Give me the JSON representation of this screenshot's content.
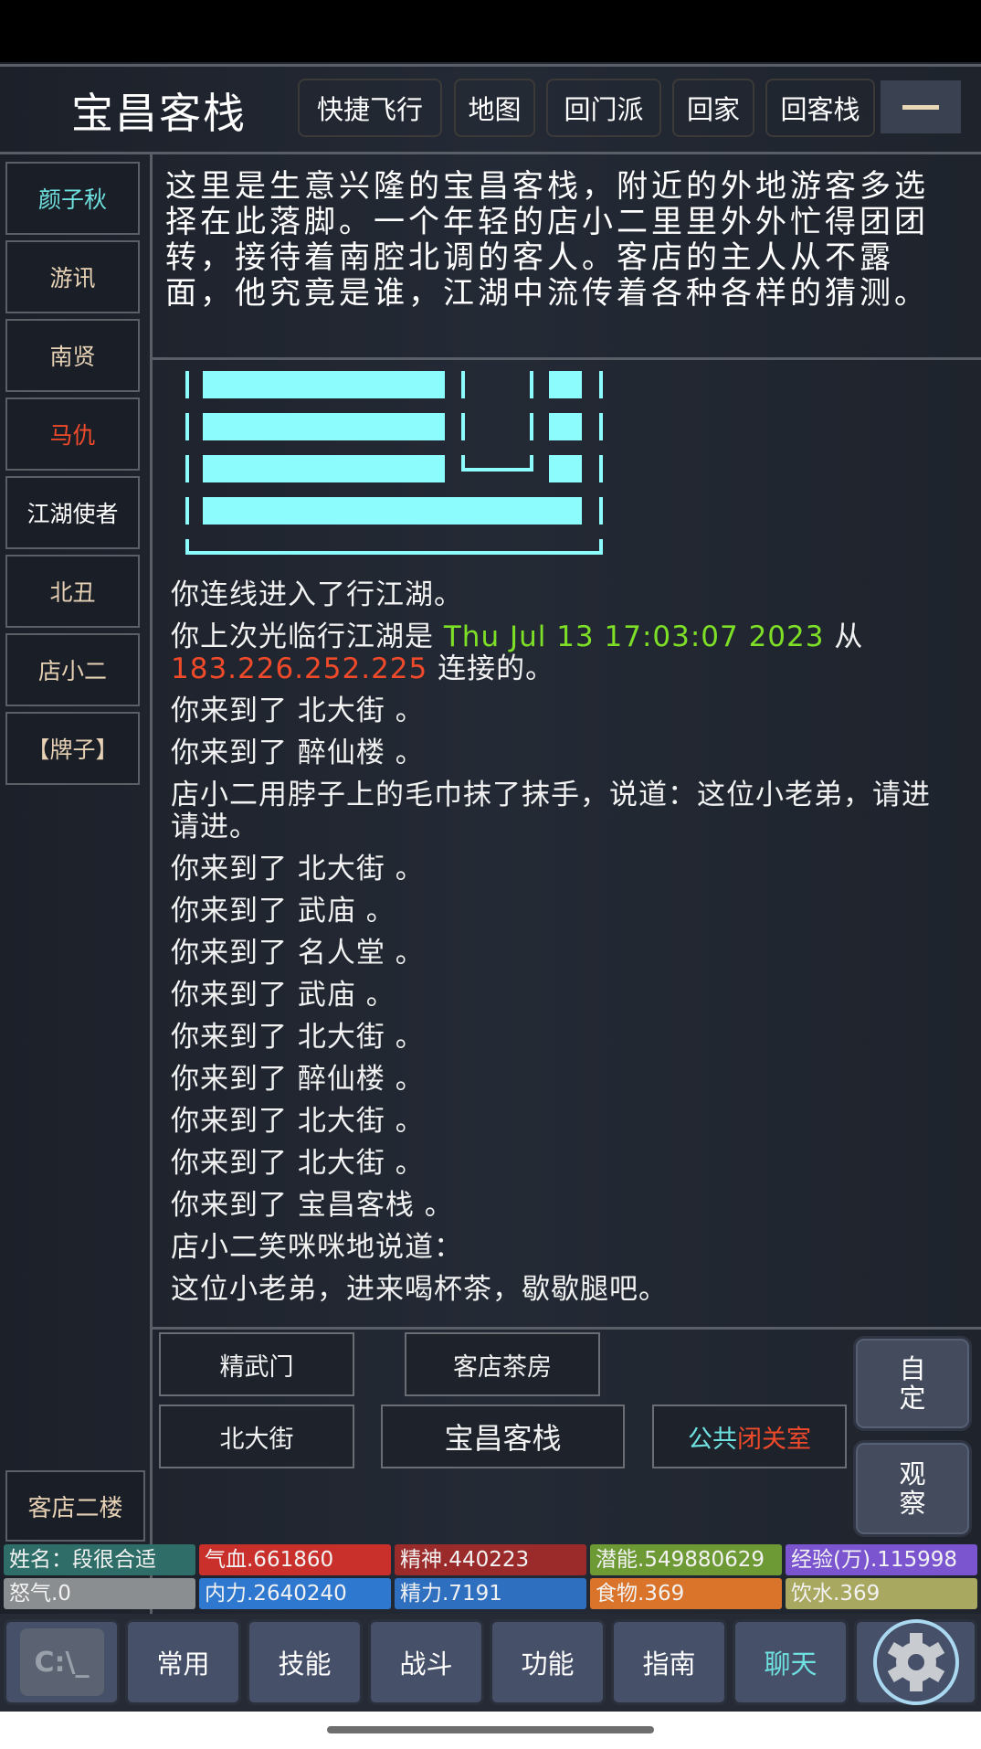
{
  "header": {
    "title": "宝昌客栈",
    "buttons": [
      "快捷飞行",
      "地图",
      "回门派",
      "回家",
      "回客栈"
    ],
    "menu_icon": "minus-icon"
  },
  "sidebar": {
    "npcs": [
      {
        "label": "颜子秋",
        "color": "#6fe0e0"
      },
      {
        "label": "游讯",
        "color": "#e7d1b5"
      },
      {
        "label": "南贤",
        "color": "#e7d1b5"
      },
      {
        "label": "马仇",
        "color": "#f04a2a"
      },
      {
        "label": "江湖使者",
        "color": "#ffffff"
      },
      {
        "label": "北丑",
        "color": "#e7d1b5"
      },
      {
        "label": "店小二",
        "color": "#e7d1b5"
      },
      {
        "label": "【牌子】",
        "color": "#e7d1b5"
      }
    ],
    "floor": "客店二楼"
  },
  "description": "这里是生意兴隆的宝昌客栈，附近的外地游客多选择在此落脚。一个年轻的店小二里里外外忙得团团转，接待着南腔北调的客人。客店的主人从不露面，他究竟是谁，江湖中流传着各种各样的猜测。",
  "log": {
    "connect": "你连线进入了行江湖。",
    "last_visit_prefix": "你上次光临行江湖是 ",
    "last_visit_time": "Thu Jul 13 17:03:07 2023",
    "last_visit_from": " 从",
    "last_visit_ip": "183.226.252.225",
    "last_visit_suffix": " 连接的。",
    "lines": [
      "你来到了 北大街 。",
      "你来到了 醉仙楼 。",
      "店小二用脖子上的毛巾抹了抹手，说道：这位小老弟，请进请进。",
      "你来到了 北大街 。",
      "你来到了 武庙 。",
      "你来到了 名人堂 。",
      "你来到了 武庙 。",
      "你来到了 北大街 。",
      "你来到了 醉仙楼 。",
      "你来到了 北大街 。",
      "你来到了 北大街 。",
      "你来到了 宝昌客栈 。",
      "店小二笑咪咪地说道：",
      "这位小老弟，进来喝杯茶，歇歇腿吧。"
    ],
    "colors": {
      "time": "#7ee026",
      "ip": "#f04a2a",
      "art": "#8cfcfc"
    }
  },
  "exits": {
    "north_west": "精武门",
    "north_east": "客店茶房",
    "west": "北大街",
    "here": "宝昌客栈",
    "east_a": "公共",
    "east_b": "闭关室",
    "east_a_color": "#6fe0e0",
    "east_b_color": "#f04a2a"
  },
  "right_buttons": {
    "custom": "自\n定",
    "observe": "观\n察"
  },
  "stats": [
    {
      "label": "姓名：段很合适",
      "color": "#2f6e68"
    },
    {
      "label": "气血.661860",
      "color": "#c9302c"
    },
    {
      "label": "精神.440223",
      "color": "#9b2a2a"
    },
    {
      "label": "潜能.549880629",
      "color": "#6e9a35"
    },
    {
      "label": "经验(万).115998",
      "color": "#7b55d0"
    },
    {
      "label": "怒气.0",
      "color": "#8a8e90"
    },
    {
      "label": "内力.2640240",
      "color": "#2f78cf"
    },
    {
      "label": "精力.7191",
      "color": "#2f6fc0"
    },
    {
      "label": "食物.369",
      "color": "#d9742a"
    },
    {
      "label": "饮水.369",
      "color": "#a9a860"
    }
  ],
  "nav": {
    "terminal": "C:\\_",
    "items": [
      "常用",
      "技能",
      "战斗",
      "功能",
      "指南",
      "聊天"
    ],
    "active_color": "#6fe0e0",
    "settings_icon": "gear-icon"
  }
}
